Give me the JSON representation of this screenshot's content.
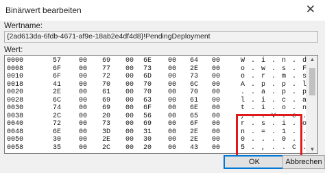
{
  "window": {
    "title": "Binärwert bearbeiten",
    "close_glyph": "✕"
  },
  "name_label": "Wertname:",
  "name_value": "{2ad613da-6fdb-4671-af9e-18ab2e4df4d8}!PendingDeployment",
  "value_label": "Wert:",
  "hex_rows": [
    {
      "offset": "0000",
      "bytes": [
        "57",
        "00",
        "69",
        "00",
        "6E",
        "00",
        "64",
        "00"
      ],
      "ascii": "W . i . n . d ."
    },
    {
      "offset": "0008",
      "bytes": [
        "6F",
        "00",
        "77",
        "00",
        "73",
        "00",
        "2E",
        "00"
      ],
      "ascii": "o . w . s . F ."
    },
    {
      "offset": "0010",
      "bytes": [
        "6F",
        "00",
        "72",
        "00",
        "6D",
        "00",
        "73",
        "00"
      ],
      "ascii": "o . r . m . s ."
    },
    {
      "offset": "0018",
      "bytes": [
        "41",
        "00",
        "70",
        "00",
        "70",
        "00",
        "6C",
        "00"
      ],
      "ascii": "A . p . p . l ."
    },
    {
      "offset": "0020",
      "bytes": [
        "2E",
        "00",
        "61",
        "00",
        "70",
        "00",
        "70",
        "00"
      ],
      "ascii": ". . a . p . p ."
    },
    {
      "offset": "0028",
      "bytes": [
        "6C",
        "00",
        "69",
        "00",
        "63",
        "00",
        "61",
        "00"
      ],
      "ascii": "l . i . c . a ."
    },
    {
      "offset": "0030",
      "bytes": [
        "74",
        "00",
        "69",
        "00",
        "6F",
        "00",
        "6E",
        "00"
      ],
      "ascii": "t . i . o . n ."
    },
    {
      "offset": "0038",
      "bytes": [
        "2C",
        "00",
        "20",
        "00",
        "56",
        "00",
        "65",
        "00"
      ],
      "ascii": ", . . V . e ."
    },
    {
      "offset": "0040",
      "bytes": [
        "72",
        "00",
        "73",
        "00",
        "69",
        "00",
        "6F",
        "00"
      ],
      "ascii": "r . s . i . o ."
    },
    {
      "offset": "0048",
      "bytes": [
        "6E",
        "00",
        "3D",
        "00",
        "31",
        "00",
        "2E",
        "00"
      ],
      "ascii": "n . = . 1 . . ."
    },
    {
      "offset": "0050",
      "bytes": [
        "30",
        "00",
        "2E",
        "00",
        "30",
        "00",
        "2E",
        "00"
      ],
      "ascii": "0 . . . 0 . . ."
    },
    {
      "offset": "0058",
      "bytes": [
        "35",
        "00",
        "2C",
        "00",
        "20",
        "00",
        "43",
        "00"
      ],
      "ascii": "5 . , . . C ."
    }
  ],
  "buttons": {
    "ok": "OK",
    "cancel": "Abbrechen"
  },
  "colors": {
    "highlight": "#e01a1a",
    "ok_border": "#0078d7"
  }
}
